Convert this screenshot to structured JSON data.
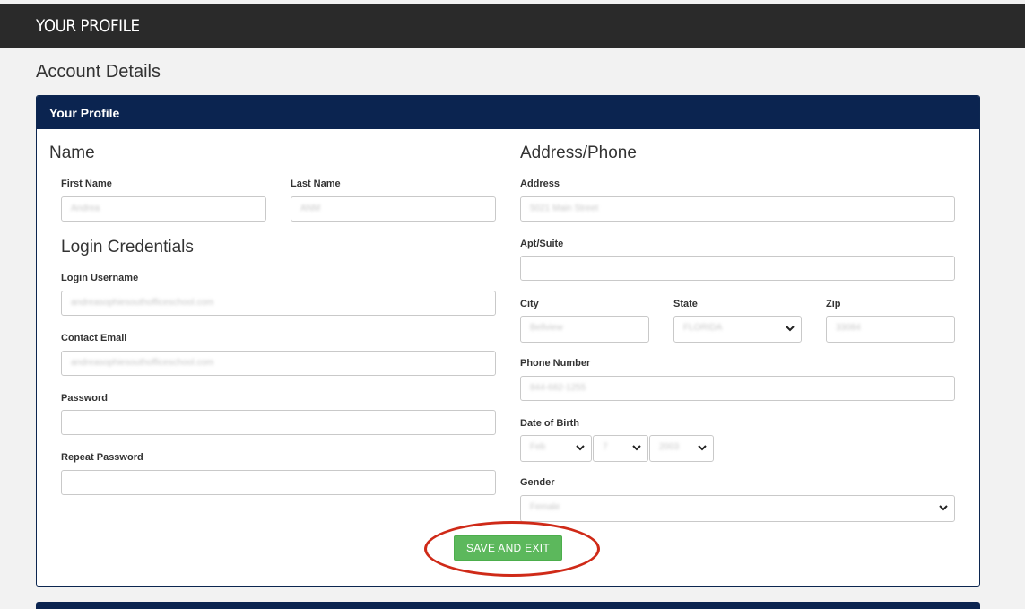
{
  "header": {
    "title": "YOUR PROFILE"
  },
  "page": {
    "section_title": "Account Details"
  },
  "panel": {
    "title": "Your Profile"
  },
  "name_section": {
    "heading": "Name",
    "first_name": {
      "label": "First Name",
      "value": "Andrea"
    },
    "last_name": {
      "label": "Last Name",
      "value": "ANM"
    }
  },
  "login_section": {
    "heading": "Login Credentials",
    "username": {
      "label": "Login Username",
      "value": "andreasophiesouthofficeschool.com"
    },
    "contact_email": {
      "label": "Contact Email",
      "value": "andreasophiesouthofficeschool.com"
    },
    "password": {
      "label": "Password",
      "value": ""
    },
    "repeat_password": {
      "label": "Repeat Password",
      "value": ""
    }
  },
  "address_section": {
    "heading": "Address/Phone",
    "address": {
      "label": "Address",
      "value": "5021 Main Street"
    },
    "apt": {
      "label": "Apt/Suite",
      "value": ""
    },
    "city": {
      "label": "City",
      "value": "Bellview"
    },
    "state": {
      "label": "State",
      "value": "FLORIDA"
    },
    "zip": {
      "label": "Zip",
      "value": "33084"
    },
    "phone": {
      "label": "Phone Number",
      "value": "844-682-1255"
    },
    "dob": {
      "label": "Date of Birth",
      "month": "Feb",
      "day": "7",
      "year": "2003"
    },
    "gender": {
      "label": "Gender",
      "value": "Female"
    }
  },
  "actions": {
    "save_label": "SAVE AND EXIT"
  },
  "colors": {
    "header_bg": "#2a2a2a",
    "panel_head": "#0b2450",
    "save_button": "#5cb85c",
    "highlight_circle": "#cf2a18"
  }
}
